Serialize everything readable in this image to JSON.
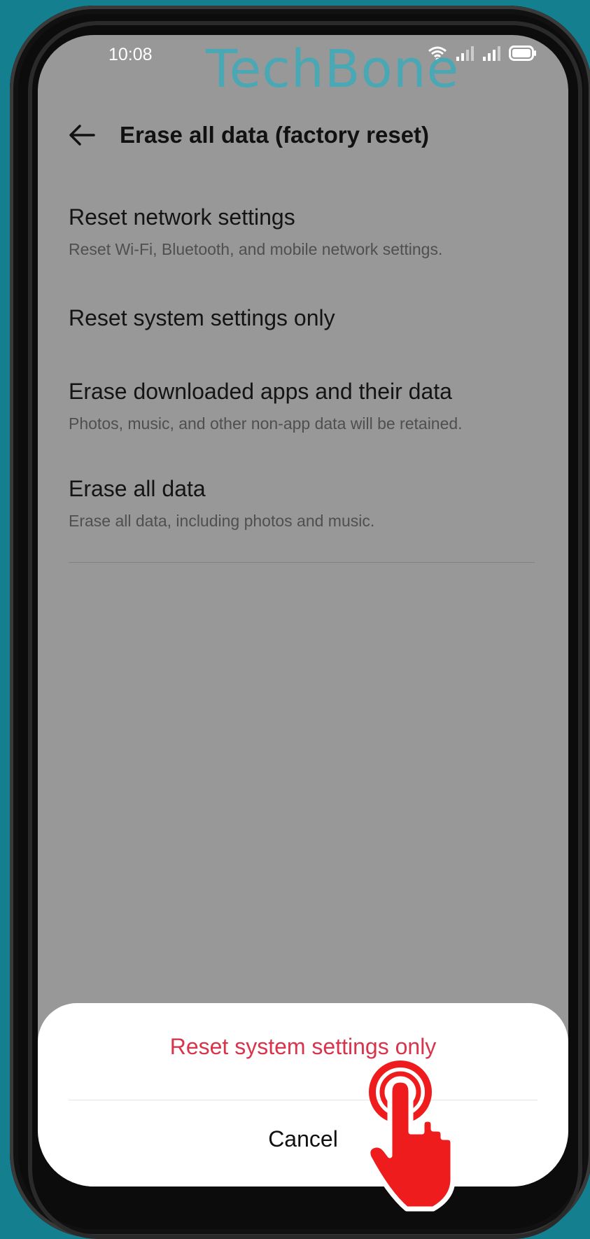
{
  "status_bar": {
    "time": "10:08",
    "icons": [
      "wifi-icon",
      "signal-icon",
      "signal-icon",
      "battery-icon"
    ]
  },
  "watermark": "TechBone",
  "header": {
    "title": "Erase all data (factory reset)",
    "back_icon": "arrow-left-icon"
  },
  "settings": {
    "items": [
      {
        "title": "Reset network settings",
        "subtitle": "Reset Wi-Fi, Bluetooth, and mobile network settings."
      },
      {
        "title": "Reset system settings only",
        "subtitle": ""
      },
      {
        "title": "Erase downloaded apps and their data",
        "subtitle": "Photos, music, and other non-app data will be retained."
      },
      {
        "title": "Erase all data",
        "subtitle": "Erase all data, including photos and music."
      }
    ]
  },
  "dialog": {
    "confirm_label": "Reset system settings only",
    "cancel_label": "Cancel"
  },
  "colors": {
    "background": "#14808f",
    "dim_overlay": "#989898",
    "accent": "#d9344b",
    "watermark": "#45a9b5",
    "tap_hand": "#ee1c1c"
  }
}
